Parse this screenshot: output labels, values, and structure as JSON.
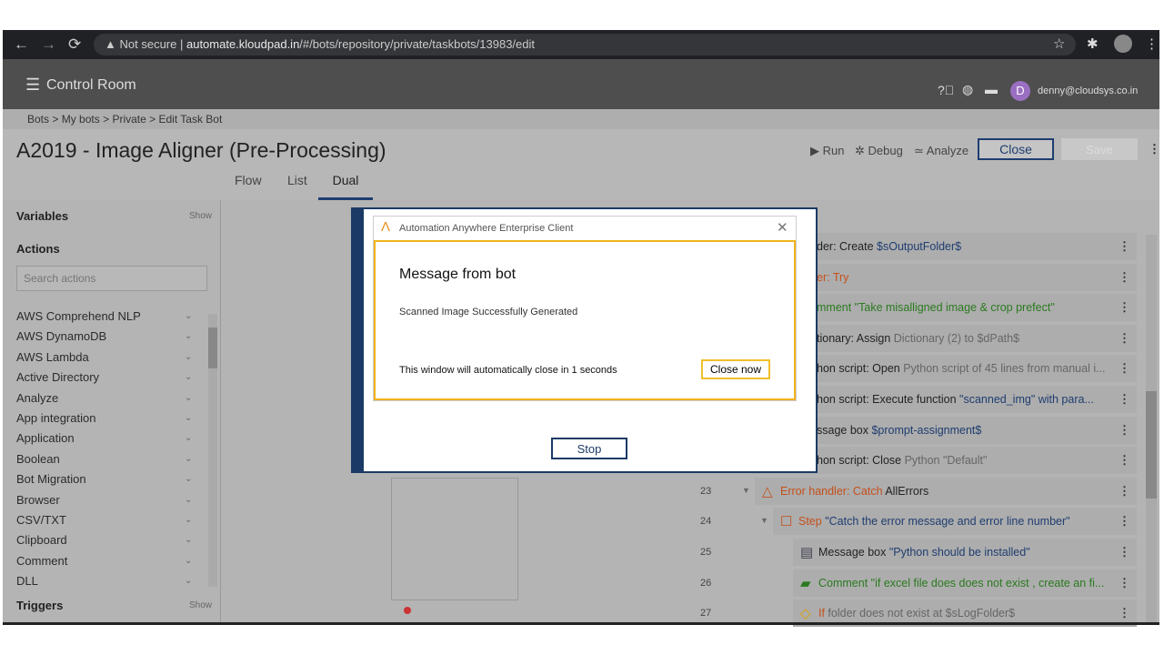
{
  "browser": {
    "not_secure": "Not secure",
    "url_host": "automate.kloudpad.in",
    "url_path": "/#/bots/repository/private/taskbots/13983/edit"
  },
  "header": {
    "app_title": "Control Room",
    "user_initial": "D",
    "user_email": "denny@cloudsys.co.in"
  },
  "breadcrumb": [
    "Bots",
    ">",
    "My bots",
    ">",
    "Private",
    ">",
    "Edit Task Bot"
  ],
  "bot": {
    "title": "A2019 - Image Aligner (Pre-Processing)",
    "run": "Run",
    "debug": "Debug",
    "analyze": "Analyze",
    "close": "Close",
    "save": "Save"
  },
  "tabs": [
    "Flow",
    "List",
    "Dual"
  ],
  "left": {
    "variables": "Variables",
    "show": "Show",
    "actions": "Actions",
    "search_placeholder": "Search actions",
    "triggers": "Triggers",
    "items": [
      "AWS Comprehend NLP",
      "AWS DynamoDB",
      "AWS Lambda",
      "Active Directory",
      "Analyze",
      "App integration",
      "Application",
      "Boolean",
      "Bot Migration",
      "Browser",
      "CSV/TXT",
      "Clipboard",
      "Comment",
      "DLL"
    ]
  },
  "rows": [
    {
      "ln": "",
      "a": "der: Create ",
      "b": "$sOutputFolder$",
      "ca": "",
      "cb": "blue"
    },
    {
      "ln": "",
      "a": "er: Try",
      "b": "",
      "ca": "orange",
      "cb": ""
    },
    {
      "ln": "",
      "a": "mment \"Take misalligned image & crop prefect\"",
      "b": "",
      "ca": "green",
      "cb": ""
    },
    {
      "ln": "",
      "a": "tionary: Assign ",
      "b": "Dictionary (2) to $dPath$",
      "ca": "",
      "cb": "gray"
    },
    {
      "ln": "",
      "a": "hon script: Open ",
      "b": "Python script of 45 lines from manual i...",
      "ca": "",
      "cb": "gray"
    },
    {
      "ln": "",
      "a": "hon script: Execute function ",
      "b": "\"scanned_img\" with para...",
      "ca": "",
      "cb": "blue"
    },
    {
      "ln": "",
      "a": "ssage box ",
      "b": "$prompt-assignment$",
      "ca": "",
      "cb": "blue"
    },
    {
      "ln": "",
      "a": "hon script: Close ",
      "b": "Python \"Default\"",
      "ca": "",
      "cb": "gray"
    },
    {
      "ln": "23",
      "a": "Error handler: Catch ",
      "b": "AllErrors",
      "ca": "orange",
      "cb": ""
    },
    {
      "ln": "24",
      "a": "Step ",
      "b": "\"Catch the error message and error line number\"",
      "ca": "orange",
      "cb": "blue"
    },
    {
      "ln": "25",
      "a": "Message box ",
      "b": "\"Python should be installed\"",
      "ca": "",
      "cb": "blue"
    },
    {
      "ln": "26",
      "a": "Comment \"if excel file does does not exist , create an fi...",
      "b": "",
      "ca": "green",
      "cb": ""
    },
    {
      "ln": "27",
      "a": "If ",
      "b": "folder does not exist at $sLogFolder$",
      "ca": "orange",
      "cb": "gray"
    }
  ],
  "dialog": {
    "window_title": "Automation Anywhere Enterprise Client",
    "heading": "Message from bot",
    "message": "Scanned Image Successfully Generated",
    "countdown": "This window will automatically close in 1 seconds",
    "close_now": "Close now",
    "stop": "Stop"
  }
}
